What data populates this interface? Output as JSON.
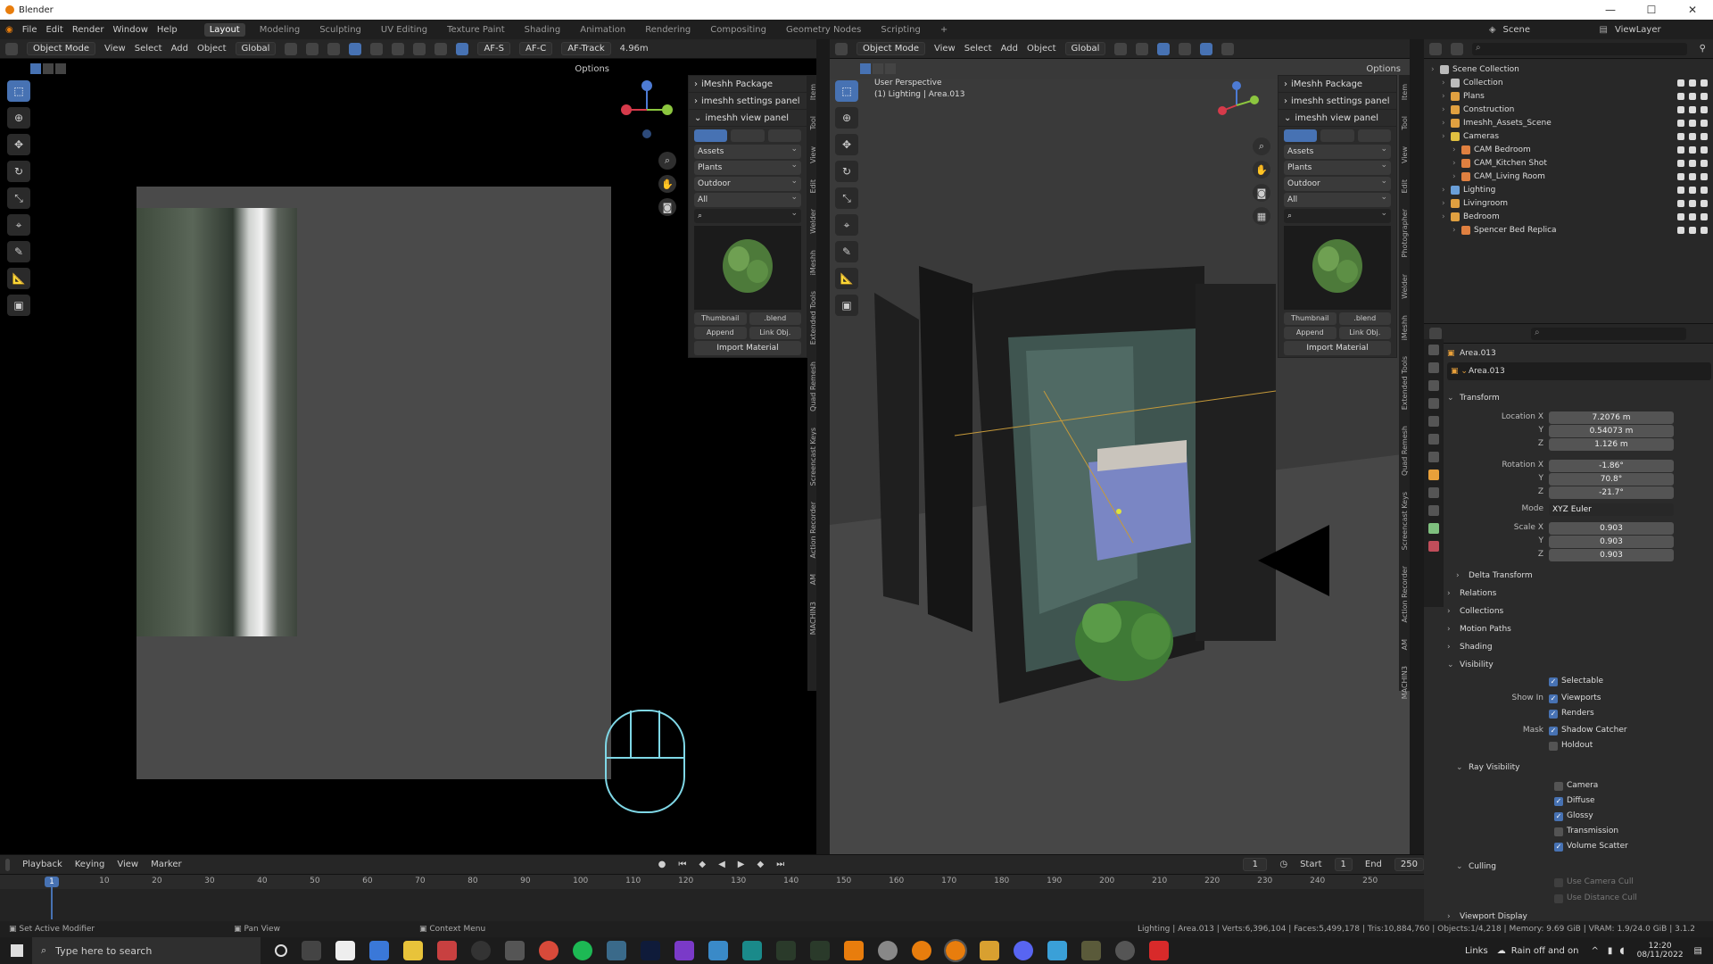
{
  "window": {
    "title": "Blender"
  },
  "menu": {
    "file": "File",
    "edit": "Edit",
    "render": "Render",
    "window": "Window",
    "help": "Help"
  },
  "workspaces": [
    "Layout",
    "Modeling",
    "Sculpting",
    "UV Editing",
    "Texture Paint",
    "Shading",
    "Animation",
    "Rendering",
    "Compositing",
    "Geometry Nodes",
    "Scripting"
  ],
  "left_header": {
    "mode": "Object Mode",
    "view": "View",
    "select": "Select",
    "add": "Add",
    "object": "Object",
    "orientation": "Global",
    "aftrack": "AF-Track",
    "af_s": "AF-S",
    "af_c": "AF-C",
    "distance": "4.96m",
    "options": "Options"
  },
  "right_header": {
    "mode": "Object Mode",
    "view": "View",
    "select": "Select",
    "add": "Add",
    "object": "Object",
    "orientation": "Global",
    "options": "Options"
  },
  "right_viewport": {
    "perspective": "User Perspective",
    "object_info": "(1) Lighting | Area.013"
  },
  "imeshh": {
    "package": "iMeshh Package",
    "settings": "imeshh settings panel",
    "view": "imeshh view panel",
    "dd1": "Assets",
    "dd2": "Plants",
    "dd3": "Outdoor",
    "dd4": "All",
    "thumbnail": "Thumbnail",
    "blend": ".blend",
    "append": "Append",
    "link": "Link Obj.",
    "import_material": "Import Material"
  },
  "side_tabs": [
    "Item",
    "Tool",
    "View",
    "Edit",
    "Photographer",
    "Welder",
    "iMeshh",
    "Extended Tools",
    "Quad Remesh",
    "Screencast Keys",
    "Action Recorder",
    "AM",
    "MACHIN3"
  ],
  "outliner": {
    "scene": "Scene",
    "view_layer": "ViewLayer",
    "rows": [
      {
        "label": "Scene Collection",
        "depth": 0,
        "color": "#bbbbbb"
      },
      {
        "label": "Collection",
        "depth": 1,
        "color": "#bbbbbb"
      },
      {
        "label": "Plans",
        "depth": 1,
        "color": "#e0a040"
      },
      {
        "label": "Construction",
        "depth": 1,
        "color": "#e0a040"
      },
      {
        "label": "Imeshh_Assets_Scene",
        "depth": 1,
        "color": "#e0a040"
      },
      {
        "label": "Cameras",
        "depth": 1,
        "color": "#e0c040"
      },
      {
        "label": "CAM Bedroom",
        "depth": 2,
        "color": "#e08040"
      },
      {
        "label": "CAM_Kitchen Shot",
        "depth": 2,
        "color": "#e08040"
      },
      {
        "label": "CAM_Living Room",
        "depth": 2,
        "color": "#e08040"
      },
      {
        "label": "Lighting",
        "depth": 1,
        "color": "#6a9fd8"
      },
      {
        "label": "Livingroom",
        "depth": 1,
        "color": "#e0a040"
      },
      {
        "label": "Bedroom",
        "depth": 1,
        "color": "#e0a040"
      },
      {
        "label": "Spencer Bed Replica",
        "depth": 2,
        "color": "#e08040"
      }
    ]
  },
  "properties": {
    "object": "Area.013",
    "object_name": "Area.013",
    "transform": "Transform",
    "location_label": "Location X",
    "loc_x": "7.2076 m",
    "loc_y": "0.54073 m",
    "loc_z": "1.126 m",
    "rotation_label": "Rotation X",
    "rot_x": "-1.86°",
    "rot_y": "70.8°",
    "rot_z": "-21.7°",
    "mode_label": "Mode",
    "mode": "XYZ Euler",
    "scale_label": "Scale X",
    "scale_x": "0.903",
    "scale_y": "0.903",
    "scale_z": "0.903",
    "y": "Y",
    "z": "Z",
    "delta": "Delta Transform",
    "relations": "Relations",
    "collections": "Collections",
    "motion_paths": "Motion Paths",
    "shading": "Shading",
    "visibility": "Visibility",
    "selectable": "Selectable",
    "show_in": "Show In",
    "viewports": "Viewports",
    "renders": "Renders",
    "mask": "Mask",
    "shadow_catcher": "Shadow Catcher",
    "holdout": "Holdout",
    "ray_visibility": "Ray Visibility",
    "camera": "Camera",
    "diffuse": "Diffuse",
    "glossy": "Glossy",
    "transmission": "Transmission",
    "volume_scatter": "Volume Scatter",
    "culling": "Culling",
    "camera_cull": "Use Camera Cull",
    "distance_cull": "Use Distance Cull",
    "viewport_display": "Viewport Display"
  },
  "timeline": {
    "playback": "Playback",
    "keying": "Keying",
    "view": "View",
    "marker": "Marker",
    "current": "1",
    "start_label": "Start",
    "start": "1",
    "end_label": "End",
    "end": "250",
    "ticks": [
      "1",
      "10",
      "20",
      "30",
      "40",
      "50",
      "60",
      "70",
      "80",
      "90",
      "100",
      "110",
      "120",
      "130",
      "140",
      "150",
      "160",
      "170",
      "180",
      "190",
      "200",
      "210",
      "220",
      "230",
      "240",
      "250"
    ]
  },
  "status": {
    "a": "Set Active Modifier",
    "b": "Pan View",
    "c": "Context Menu",
    "info": "Lighting | Area.013 | Verts:6,396,104 | Faces:5,499,178 | Tris:10,884,760 | Objects:1/4,218 | Memory: 9.69 GiB | VRAM: 1.9/24.0 GiB | 3.1.2"
  },
  "taskbar": {
    "search": "Type here to search",
    "links": "Links",
    "weather": "Rain off and on",
    "time": "12:20",
    "date": "08/11/2022"
  }
}
